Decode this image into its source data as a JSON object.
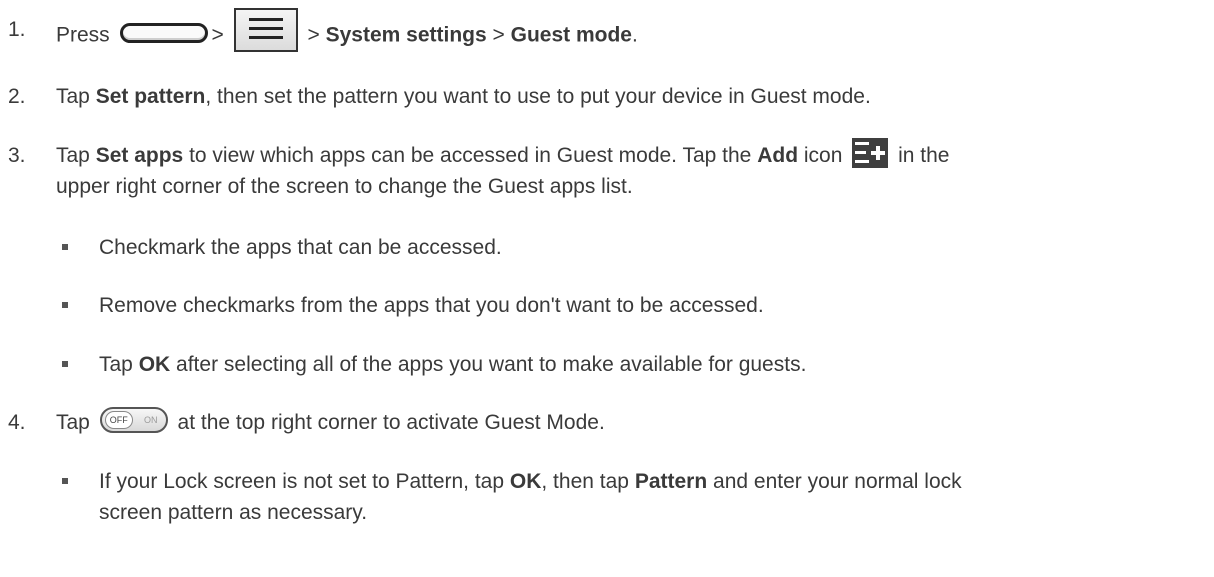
{
  "steps": [
    {
      "num": "1.",
      "press": "Press",
      "sep1": ">",
      "sep2": ">",
      "system_settings": "System settings",
      "sep3": ">",
      "guest_mode": "Guest mode",
      "period": "."
    },
    {
      "num": "2.",
      "tap": "Tap",
      "set_pattern": "Set pattern",
      "rest": ", then set the pattern you want to use to put your device in Guest mode."
    },
    {
      "num": "3.",
      "tap": "Tap",
      "set_apps": "Set apps",
      "mid": "to view which apps can be accessed in Guest mode. Tap the",
      "add": "Add",
      "icon_word": "icon",
      "rest_line1": "in the",
      "line2": "upper right corner of the screen to change the Guest apps list."
    },
    {
      "num": "4.",
      "tap": "Tap",
      "rest": "at the top right corner to activate Guest Mode."
    }
  ],
  "bullets": {
    "b1": "Checkmark the apps that can be accessed.",
    "b2": "Remove checkmarks from the apps that you don't want to be accessed.",
    "b3_tap": "Tap",
    "b3_ok": "OK",
    "b3_rest": "after selecting all of the apps you want to make available for guests.",
    "b4_pre": "If your Lock screen is not set to Pattern, tap",
    "b4_ok": "OK",
    "b4_mid": ", then tap",
    "b4_pattern": "Pattern",
    "b4_rest_line1": "and enter your normal lock",
    "b4_line2": "screen pattern as necessary."
  },
  "icons": {
    "home_key": "home-key-icon",
    "menu_key": "menu-key-icon",
    "add": "add-icon",
    "toggle": "toggle-icon"
  },
  "toggle": {
    "off_label": "OFF",
    "on_label": "ON"
  }
}
